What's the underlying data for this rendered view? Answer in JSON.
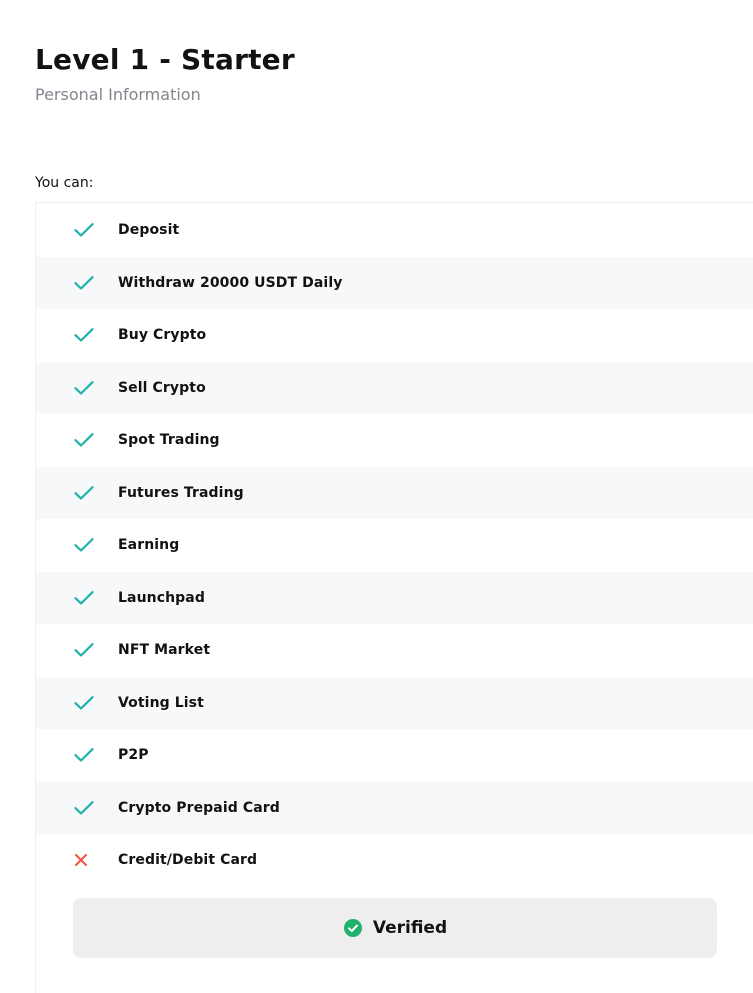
{
  "header": {
    "title": "Level 1 - Starter",
    "subtitle": "Personal Information"
  },
  "features": {
    "intro": "You can:",
    "items": [
      {
        "label": "Deposit",
        "allowed": true,
        "icon": "check-icon"
      },
      {
        "label": "Withdraw 20000 USDT Daily",
        "allowed": true,
        "icon": "check-icon"
      },
      {
        "label": "Buy Crypto",
        "allowed": true,
        "icon": "check-icon"
      },
      {
        "label": "Sell Crypto",
        "allowed": true,
        "icon": "check-icon"
      },
      {
        "label": "Spot Trading",
        "allowed": true,
        "icon": "check-icon"
      },
      {
        "label": "Futures Trading",
        "allowed": true,
        "icon": "check-icon"
      },
      {
        "label": "Earning",
        "allowed": true,
        "icon": "check-icon"
      },
      {
        "label": "Launchpad",
        "allowed": true,
        "icon": "check-icon"
      },
      {
        "label": "NFT Market",
        "allowed": true,
        "icon": "check-icon"
      },
      {
        "label": "Voting List",
        "allowed": true,
        "icon": "check-icon"
      },
      {
        "label": "P2P",
        "allowed": true,
        "icon": "check-icon"
      },
      {
        "label": "Crypto Prepaid Card",
        "allowed": true,
        "icon": "check-icon"
      },
      {
        "label": "Credit/Debit Card",
        "allowed": false,
        "icon": "cross-icon"
      }
    ]
  },
  "status": {
    "label": "Verified",
    "icon": "check-circle-icon"
  },
  "colors": {
    "check": "#20b2aa",
    "cross": "#f25a4b",
    "verified": "#20b26c",
    "row_alt_bg": "#f7f8fa",
    "button_bg": "#eeeeee"
  }
}
